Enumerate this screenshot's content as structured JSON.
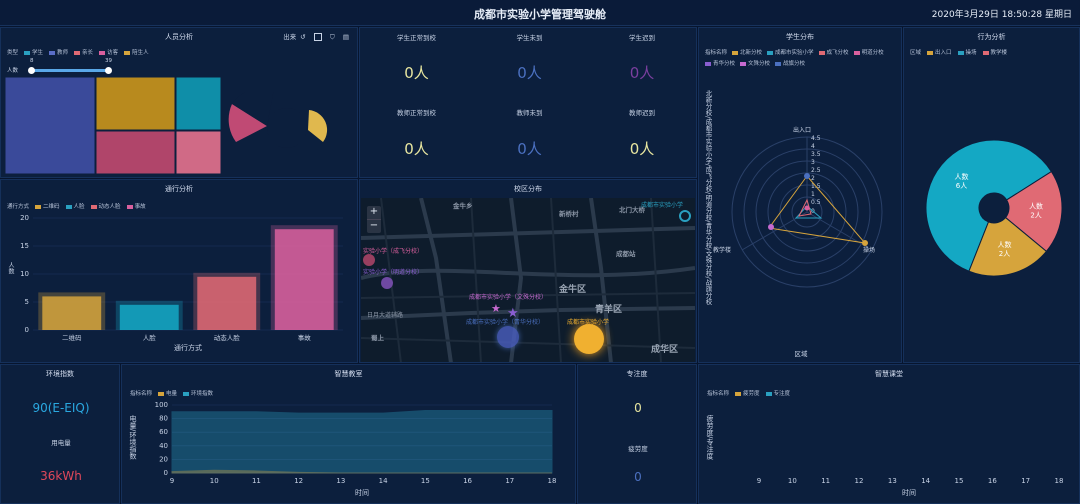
{
  "header": {
    "title": "成都市实验小学管理驾驶舱",
    "clock": "2020年3月29日 18:50:28 星期日"
  },
  "staff": {
    "title": "人员分析",
    "toolbar_label": "出来",
    "legend_label": "类型",
    "legend": [
      {
        "name": "学生",
        "color": "#2aa0c0"
      },
      {
        "name": "教师",
        "color": "#5a6ec8"
      },
      {
        "name": "亲长",
        "color": "#e06a74"
      },
      {
        "name": "访客",
        "color": "#d9609e"
      },
      {
        "name": "陪生人",
        "color": "#d6a43c"
      }
    ],
    "slider": {
      "label": "人数",
      "min_label": "8",
      "max_label": "39",
      "min": 8,
      "max": 39
    },
    "treemap_colors": [
      "#3a4a9a",
      "#b88a1e",
      "#0f8ea8",
      "#b0456a",
      "#d06a86"
    ]
  },
  "attendance": {
    "cells": [
      {
        "label": "学生正常到校",
        "value": "0人",
        "color": "#e8e6a0"
      },
      {
        "label": "学生未到",
        "value": "0人",
        "color": "#4b70c0"
      },
      {
        "label": "学生迟到",
        "value": "0人",
        "color": "#7a3f9e"
      },
      {
        "label": "教师正常到校",
        "value": "0人",
        "color": "#e8e6a0"
      },
      {
        "label": "教师未到",
        "value": "0人",
        "color": "#4b70c0"
      },
      {
        "label": "教师迟到",
        "value": "0人",
        "color": "#e8e6a0"
      }
    ]
  },
  "student_dist": {
    "title": "学生分布",
    "legend_label": "指标名称",
    "legend": [
      {
        "name": "北新分校",
        "color": "#d6a43c"
      },
      {
        "name": "成都市实验小学",
        "color": "#2aa0c0"
      },
      {
        "name": "成飞分校",
        "color": "#e06a74"
      },
      {
        "name": "明道分校",
        "color": "#d9609e"
      },
      {
        "name": "青华分校",
        "color": "#8a5ed0"
      },
      {
        "name": "文殊分校",
        "color": "#c66ad0"
      },
      {
        "name": "战旗分校",
        "color": "#4b70c0"
      }
    ],
    "y_label": "北新分校/成都市实验小学/成飞分校/明道分校/青华分校/文殊分校/战旗分校",
    "x_label": "区域",
    "axes": [
      "出入口",
      "操场",
      "教学楼"
    ],
    "ticks": [
      "4.5",
      "4",
      "3.5",
      "3",
      "2.5",
      "2",
      "1.5",
      "1",
      "0.5",
      "0"
    ]
  },
  "behavior": {
    "title": "行为分析",
    "legend_label": "区域",
    "legend": [
      {
        "name": "出入口",
        "color": "#d6a43c"
      },
      {
        "name": "操场",
        "color": "#2aa0c0"
      },
      {
        "name": "教学楼",
        "color": "#e06a74"
      }
    ]
  },
  "traffic": {
    "title": "通行分析",
    "legend_label": "通行方式",
    "legend": [
      {
        "name": "二维码",
        "color": "#d6a43c"
      },
      {
        "name": "人脸",
        "color": "#2aa0c0"
      },
      {
        "name": "动态人脸",
        "color": "#e06a74"
      },
      {
        "name": "事故",
        "color": "#d9609e"
      }
    ],
    "y_label": "人数",
    "x_label": "通行方式"
  },
  "campus": {
    "title": "校区分布",
    "zoom_in": "+",
    "zoom_out": "−",
    "places": [
      "金牛乡",
      "新桥村",
      "北门大桥",
      "成都站",
      "金牛区",
      "青羊区",
      "成华区",
      "日月大道辅路",
      "蜀上"
    ],
    "schools": [
      {
        "name": "实验小学（成飞分校）",
        "color": "#d9609e"
      },
      {
        "name": "实验小学（明道分校）",
        "color": "#8a5ed0"
      },
      {
        "name": "成都市实验小学（文殊分校）",
        "color": "#c66ad0"
      },
      {
        "name": "成都市实验小学（青华分校）",
        "color": "#4b70c0"
      },
      {
        "name": "成都市实验小学",
        "color": "#f0b030"
      },
      {
        "name": "成都市实验小学",
        "color": "#2aa0c0"
      }
    ]
  },
  "env": {
    "title": "环境指数",
    "value": "90(E-EIQ)",
    "power_label": "用电量",
    "power_value": "36kWh"
  },
  "classroom": {
    "title": "智慧教室",
    "legend_label": "指标名称",
    "legend": [
      {
        "name": "电量",
        "color": "#d6a43c"
      },
      {
        "name": "环境指数",
        "color": "#2aa0c0"
      }
    ],
    "y_label": "电量/环境指数",
    "x_label": "时间"
  },
  "focus": {
    "title": "专注度",
    "value": "0",
    "fatigue_label": "疲劳度",
    "fatigue_value": "0"
  },
  "smart_class": {
    "title": "智慧课堂",
    "legend_label": "指标名称",
    "legend": [
      {
        "name": "疲劳度",
        "color": "#d6a43c"
      },
      {
        "name": "专注度",
        "color": "#2aa0c0"
      }
    ],
    "y_label": "疲劳度/专注度",
    "x_label": "时间"
  },
  "chart_data": [
    {
      "type": "bar",
      "title": "通行分析",
      "xlabel": "通行方式",
      "ylabel": "人数",
      "categories": [
        "二维码",
        "人脸",
        "动态人脸",
        "事故"
      ],
      "values": [
        6,
        4.5,
        9.5,
        18
      ],
      "colors": [
        "#d6a43c",
        "#14a8c4",
        "#e06a74",
        "#d9609e"
      ],
      "ylim": [
        0,
        20
      ],
      "yticks": [
        0,
        5,
        10,
        15,
        20
      ]
    },
    {
      "type": "pie",
      "title": "行为分析",
      "slices": [
        {
          "name": "操场",
          "label": "人数",
          "value": 6,
          "value_label": "6人",
          "color": "#14a8c4"
        },
        {
          "name": "教学楼",
          "label": "人数",
          "value": 2,
          "value_label": "2人",
          "color": "#e06a74"
        },
        {
          "name": "出入口",
          "label": "人数",
          "value": 2,
          "value_label": "2人",
          "color": "#d6a43c"
        }
      ]
    },
    {
      "type": "area",
      "title": "智慧教室",
      "xlabel": "时间",
      "ylabel": "电量/环境指数",
      "x": [
        9,
        10,
        11,
        12,
        13,
        14,
        15,
        16,
        17,
        18
      ],
      "ylim": [
        0,
        100
      ],
      "yticks": [
        0,
        20,
        40,
        60,
        80,
        100
      ],
      "series": [
        {
          "name": "环境指数",
          "values": [
            90,
            90,
            90,
            88,
            88,
            88,
            92,
            92,
            92,
            92
          ],
          "color": "#2aa0c0"
        },
        {
          "name": "电量",
          "values": [
            2,
            4,
            3,
            1,
            0,
            0,
            0,
            0,
            0,
            0
          ],
          "color": "#d6a43c"
        }
      ]
    },
    {
      "type": "line",
      "title": "智慧课堂",
      "xlabel": "时间",
      "x": [
        9,
        10,
        11,
        12,
        13,
        14,
        15,
        16,
        17,
        18
      ],
      "series": []
    }
  ]
}
